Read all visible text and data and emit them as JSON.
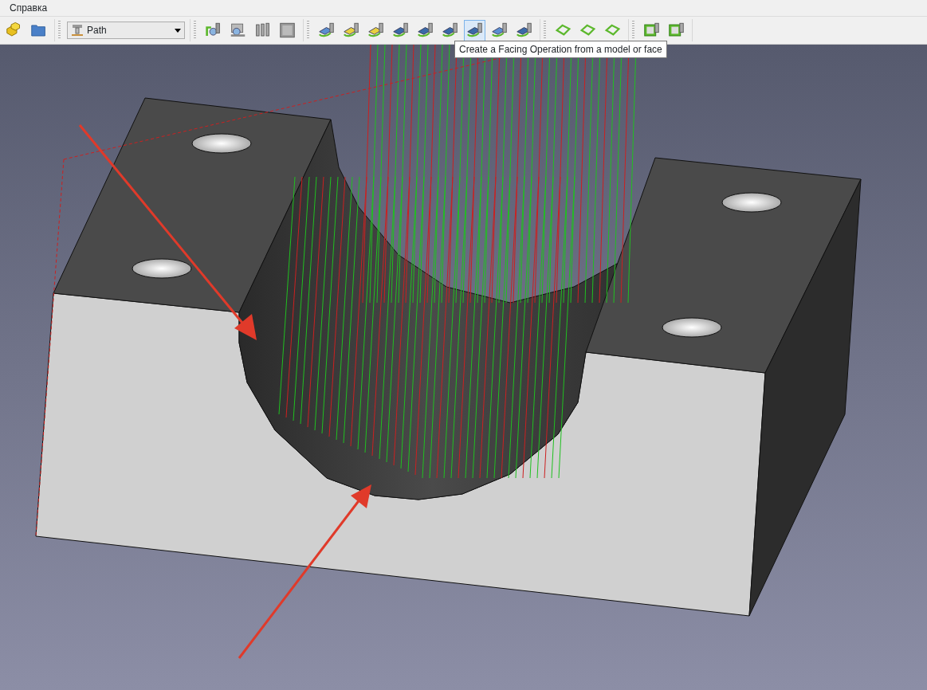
{
  "menu": [
    {
      "label": "Справка"
    }
  ],
  "toolbar": {
    "groups": [
      {
        "kind": "icons",
        "buttons": [
          {
            "selected": false
          },
          {
            "selected": false
          }
        ]
      },
      {
        "kind": "workbench",
        "value": "Path"
      },
      {
        "kind": "icons",
        "buttons": [
          {
            "selected": false
          },
          {
            "selected": false
          },
          {
            "selected": false
          },
          {
            "selected": false
          }
        ]
      },
      {
        "kind": "icons",
        "buttons": [
          {
            "selected": false
          },
          {
            "selected": false
          },
          {
            "selected": false
          },
          {
            "selected": false
          },
          {
            "selected": false
          },
          {
            "selected": false
          },
          {
            "selected": true
          },
          {
            "selected": false
          },
          {
            "selected": false
          }
        ]
      },
      {
        "kind": "icons",
        "buttons": [
          {
            "selected": false
          },
          {
            "selected": false
          },
          {
            "selected": false
          }
        ]
      },
      {
        "kind": "icons",
        "buttons": [
          {
            "selected": false
          },
          {
            "selected": false
          }
        ]
      }
    ]
  },
  "tooltip": {
    "text": "Create a Facing Operation from a model or face"
  }
}
